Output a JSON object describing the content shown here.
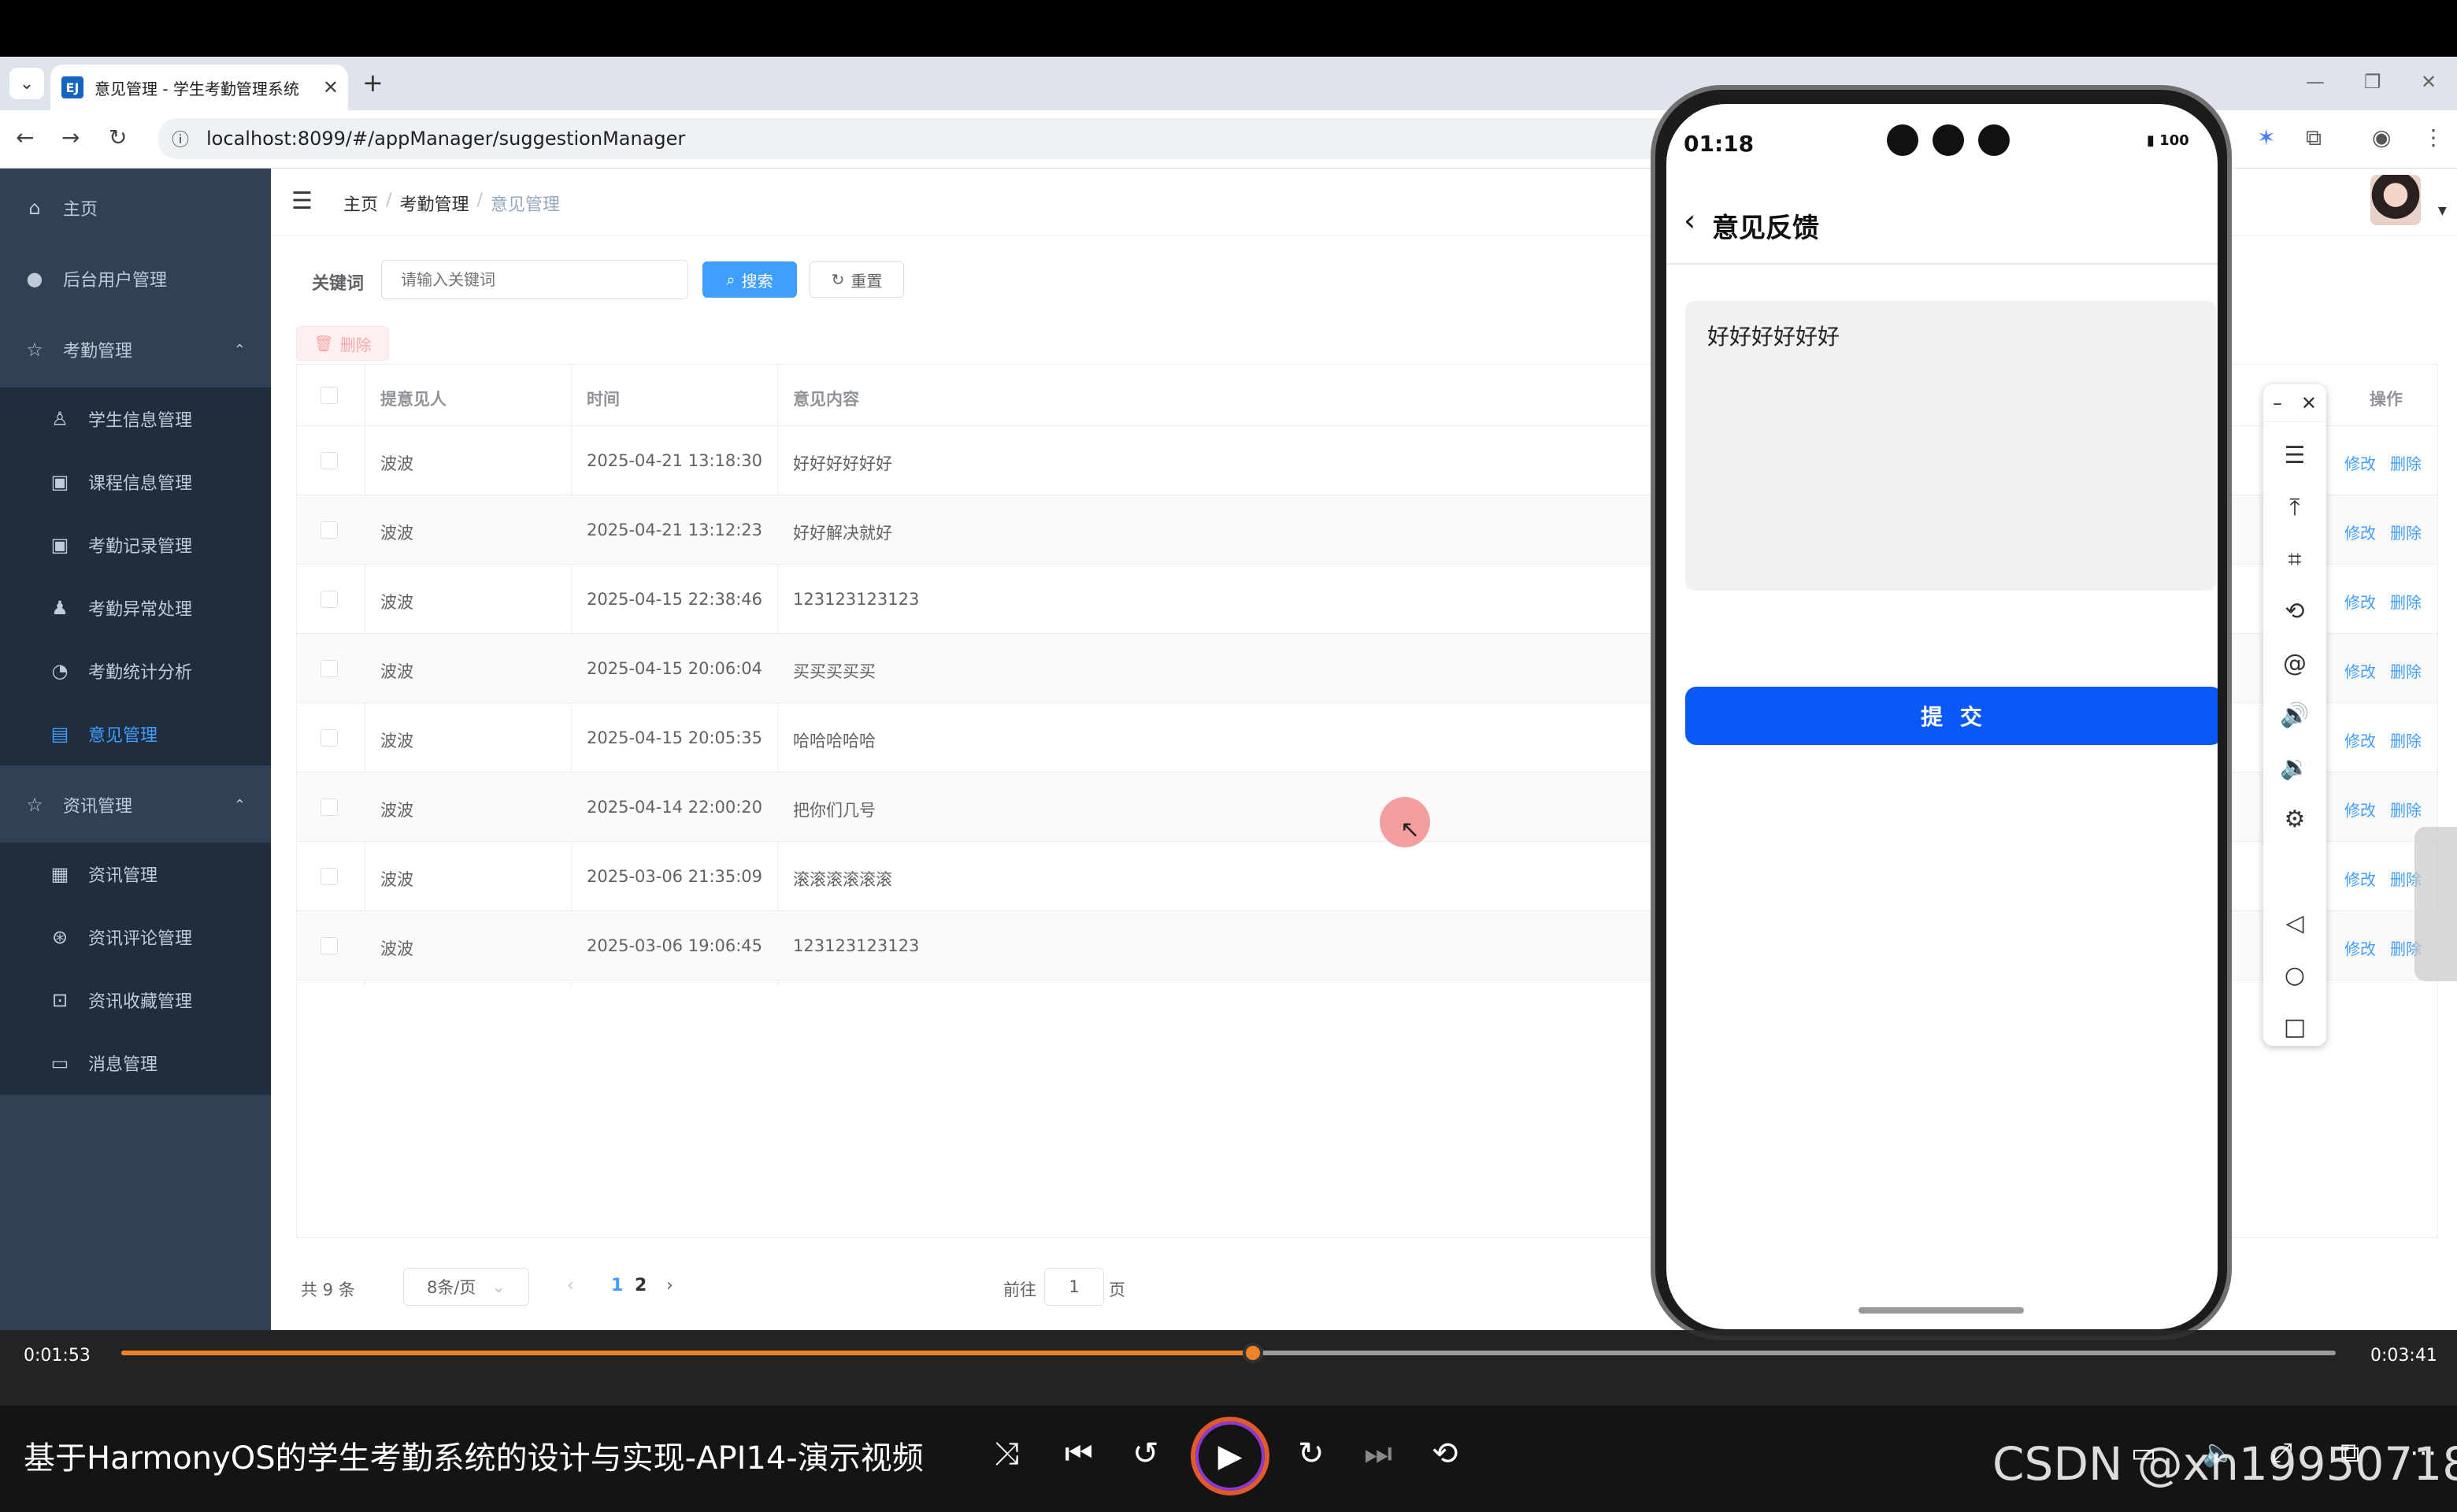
{
  "browser": {
    "tab_title": "意见管理 - 学生考勤管理系统",
    "favicon_text": "EJ",
    "url": "localhost:8099/#/appManager/suggestionManager"
  },
  "sidebar": {
    "items": [
      {
        "label": "主页",
        "icon": "home-icon",
        "level": "top"
      },
      {
        "label": "后台用户管理",
        "icon": "user-icon",
        "level": "top"
      },
      {
        "label": "考勤管理",
        "icon": "star-icon",
        "level": "top",
        "expanded": true
      },
      {
        "label": "学生信息管理",
        "icon": "person-icon",
        "level": "sub"
      },
      {
        "label": "课程信息管理",
        "icon": "clipboard-icon",
        "level": "sub"
      },
      {
        "label": "考勤记录管理",
        "icon": "clipboard-check-icon",
        "level": "sub"
      },
      {
        "label": "考勤异常处理",
        "icon": "user-alert-icon",
        "level": "sub"
      },
      {
        "label": "考勤统计分析",
        "icon": "pie-chart-icon",
        "level": "sub"
      },
      {
        "label": "意见管理",
        "icon": "document-icon",
        "level": "sub",
        "active": true
      },
      {
        "label": "资讯管理",
        "icon": "star-icon",
        "level": "top",
        "expanded": true
      },
      {
        "label": "资讯管理",
        "icon": "news-icon",
        "level": "sub"
      },
      {
        "label": "资讯评论管理",
        "icon": "comment-wheel-icon",
        "level": "sub"
      },
      {
        "label": "资讯收藏管理",
        "icon": "bookmark-icon",
        "level": "sub"
      },
      {
        "label": "消息管理",
        "icon": "message-icon",
        "level": "sub"
      }
    ]
  },
  "breadcrumb": [
    "主页",
    "考勤管理",
    "意见管理"
  ],
  "search": {
    "label": "关键词",
    "placeholder": "请输入关键词",
    "search_button": "搜索",
    "reset_button": "重置",
    "delete_button": "删除"
  },
  "table": {
    "columns": [
      "提意见人",
      "时间",
      "意见内容",
      "操作"
    ],
    "rows": [
      {
        "person": "波波",
        "time": "2025-04-21 13:18:30",
        "content": "好好好好好好"
      },
      {
        "person": "波波",
        "time": "2025-04-21 13:12:23",
        "content": "好好解决就好"
      },
      {
        "person": "波波",
        "time": "2025-04-15 22:38:46",
        "content": "123123123123"
      },
      {
        "person": "波波",
        "time": "2025-04-15 20:06:04",
        "content": "买买买买买"
      },
      {
        "person": "波波",
        "time": "2025-04-15 20:05:35",
        "content": "哈哈哈哈哈"
      },
      {
        "person": "波波",
        "time": "2025-04-14 22:00:20",
        "content": "把你们几号"
      },
      {
        "person": "波波",
        "time": "2025-03-06 21:35:09",
        "content": "滚滚滚滚滚滚"
      },
      {
        "person": "波波",
        "time": "2025-03-06 19:06:45",
        "content": "123123123123"
      }
    ],
    "row_actions": {
      "edit": "修改",
      "delete": "删除"
    }
  },
  "pagination": {
    "total": "共 9 条",
    "page_size": "8条/页",
    "pages": [
      "1",
      "2"
    ],
    "current_page": "1",
    "goto_label": "前往",
    "goto_value": "1",
    "goto_suffix": "页"
  },
  "phone": {
    "time": "01:18",
    "battery": "100",
    "title": "意见反馈",
    "textarea_value": "好好好好好好",
    "submit_label": "提 交"
  },
  "player": {
    "current_time": "0:01:53",
    "total_time": "0:03:41",
    "progress": 0.511,
    "title": "基于HarmonyOS的学生考勤系统的设计与实现-API14-演示视频",
    "watermark": "CSDN @xn19950718"
  },
  "colors": {
    "sidebar_bg": "#304156",
    "accent": "#409eff",
    "phone_button": "#0a59f7",
    "progress": "#f0822a"
  }
}
